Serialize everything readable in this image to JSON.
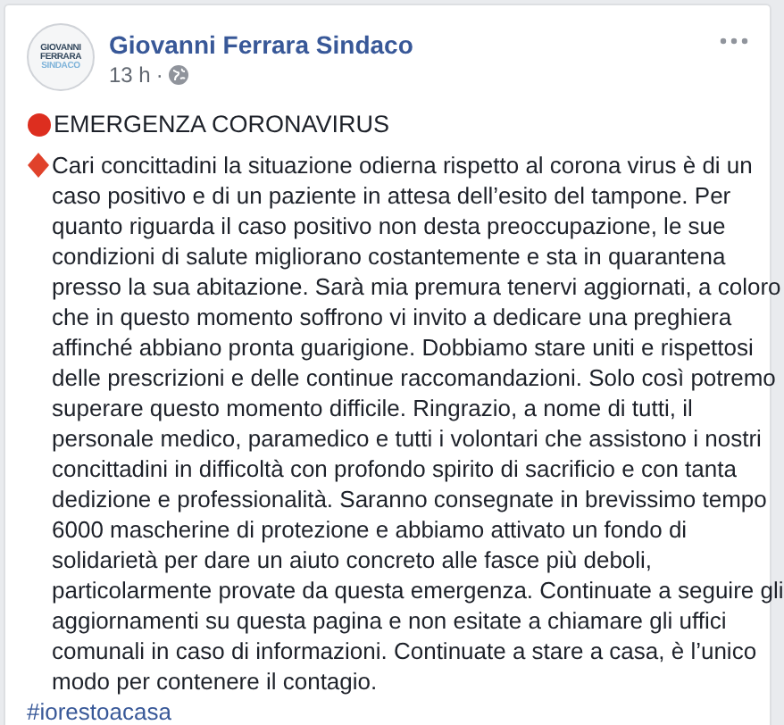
{
  "post": {
    "author": "Giovanni Ferrara Sindaco",
    "avatar_text": [
      "GIOVANNI",
      "FERRARA",
      "SINDACO"
    ],
    "time": "13 h",
    "separator": "·",
    "heading": "EMERGENZA CORONAVIRUS",
    "body_lines": [
      "Cari concittadini la situazione odierna rispetto al corona virus è di un",
      "caso positivo e di un paziente in attesa dell’esito del tampone. Per",
      "quanto riguarda il caso positivo non desta preoccupazione, le sue",
      "condizioni di salute migliorano costantemente e sta in quarantena",
      "presso la sua abitazione. Sarà mia premura tenervi aggiornati, a coloro",
      "che in questo momento soffrono vi invito a dedicare una preghiera",
      "affinché abbiano pronta guarigione. Dobbiamo stare uniti e rispettosi",
      "delle prescrizioni e delle continue raccomandazioni. Solo così potremo",
      "superare questo momento difficile. Ringrazio, a nome di tutti, il",
      "personale medico, paramedico e tutti i volontari che assistono i nostri",
      "concittadini in difficoltà con profondo spirito di sacrificio e con tanta",
      "dedizione e professionalità. Saranno consegnate in brevissimo tempo",
      "6000 mascherine di protezione e abbiamo attivato un fondo di",
      "solidarietà per dare un aiuto concreto alle fasce più deboli,",
      "particolarmente provate da questa emergenza. Continuate a seguire gli",
      "aggiornamenti su questa pagina e non esitate a chiamare gli uffici",
      "comunali in caso di informazioni. Continuate a stare a casa, è l’unico",
      "modo per contenere il contagio."
    ],
    "hashtag": "#iorestoacasa"
  }
}
